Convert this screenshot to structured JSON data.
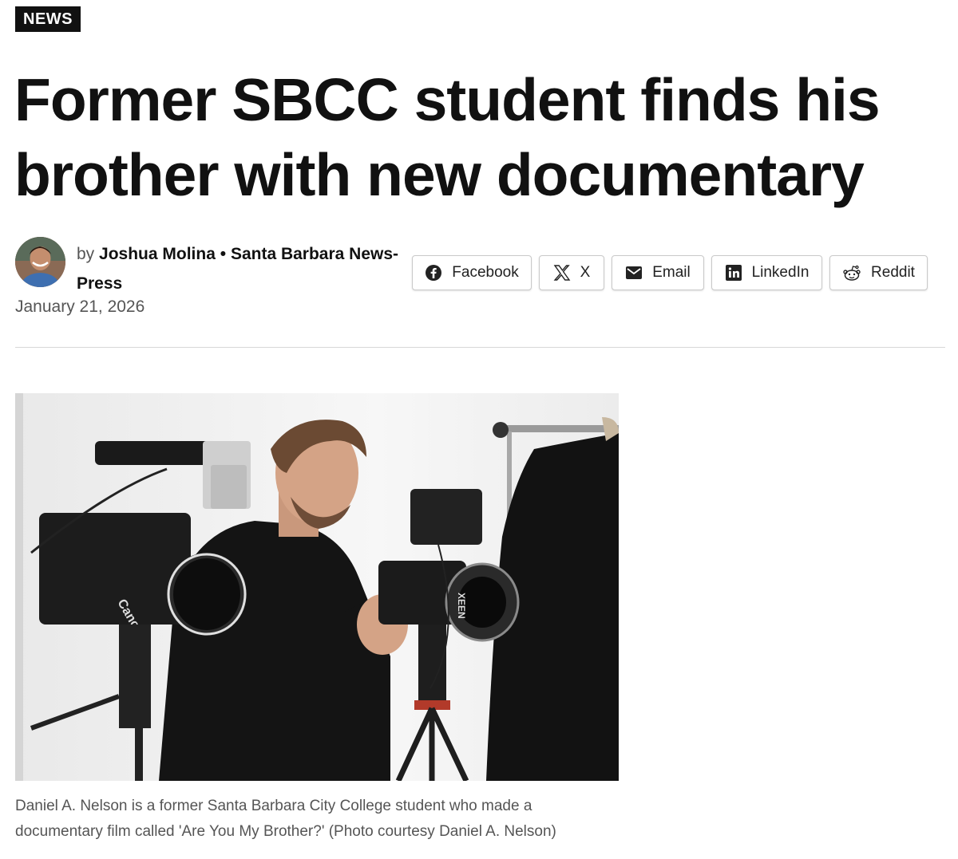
{
  "article": {
    "category": "NEWS",
    "headline": "Former SBCC student finds his brother with new documentary",
    "byline": {
      "prefix": "by",
      "author": "Joshua Molina",
      "separator": "•",
      "publication": "Santa Barbara News-Press"
    },
    "date": "January 21, 2026",
    "photo": {
      "camera_brand": "Canon",
      "lens_brand": "XEEN"
    },
    "caption": "Daniel A. Nelson is a former Santa Barbara City College student who made a documentary film called 'Are You My Brother?' (Photo courtesy Daniel A. Nelson)"
  },
  "share": [
    {
      "label": "Facebook",
      "icon": "facebook-icon"
    },
    {
      "label": "X",
      "icon": "x-icon"
    },
    {
      "label": "Email",
      "icon": "email-icon"
    },
    {
      "label": "LinkedIn",
      "icon": "linkedin-icon"
    },
    {
      "label": "Reddit",
      "icon": "reddit-icon"
    }
  ],
  "colors": {
    "text": "#111111",
    "muted": "#555555",
    "badge_bg": "#111111",
    "border": "#c9c9c9"
  }
}
